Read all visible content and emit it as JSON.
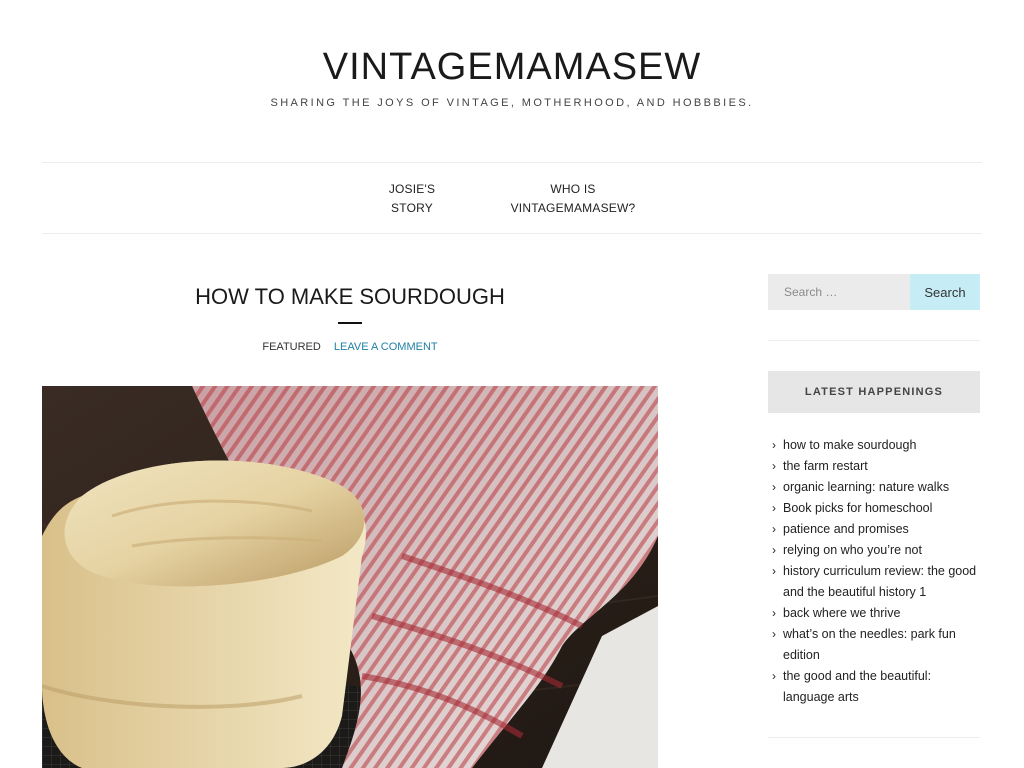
{
  "site": {
    "title": "VINTAGEMAMASEW",
    "tagline": "SHARING THE JOYS OF VINTAGE, MOTHERHOOD, AND HOBBBIES."
  },
  "nav": {
    "items": [
      {
        "line1": "JOSIE'S",
        "line2": "STORY"
      },
      {
        "line1": "WHO IS",
        "line2": "VINTAGEMAMASEW?"
      }
    ]
  },
  "post": {
    "title": "HOW TO MAKE SOURDOUGH",
    "category": "FEATURED",
    "comment_link": "LEAVE A COMMENT"
  },
  "sidebar": {
    "search": {
      "placeholder": "Search …",
      "button_label": "Search"
    },
    "widget_title": "LATEST HAPPENINGS",
    "chevron": "›",
    "recent_posts": [
      "how to make sourdough",
      "the farm restart",
      "organic learning: nature walks",
      "Book picks for homeschool",
      "patience and promises",
      "relying on who you’re not",
      "history curriculum review: the good and the beautiful history 1",
      "back where we thrive",
      "what’s on the needles: park fun edition",
      "the good and the beautiful: language arts"
    ]
  },
  "colors": {
    "link": "#1f7fa6",
    "search_button": "#c6ecf5",
    "widget_header": "#e6e6e6"
  }
}
